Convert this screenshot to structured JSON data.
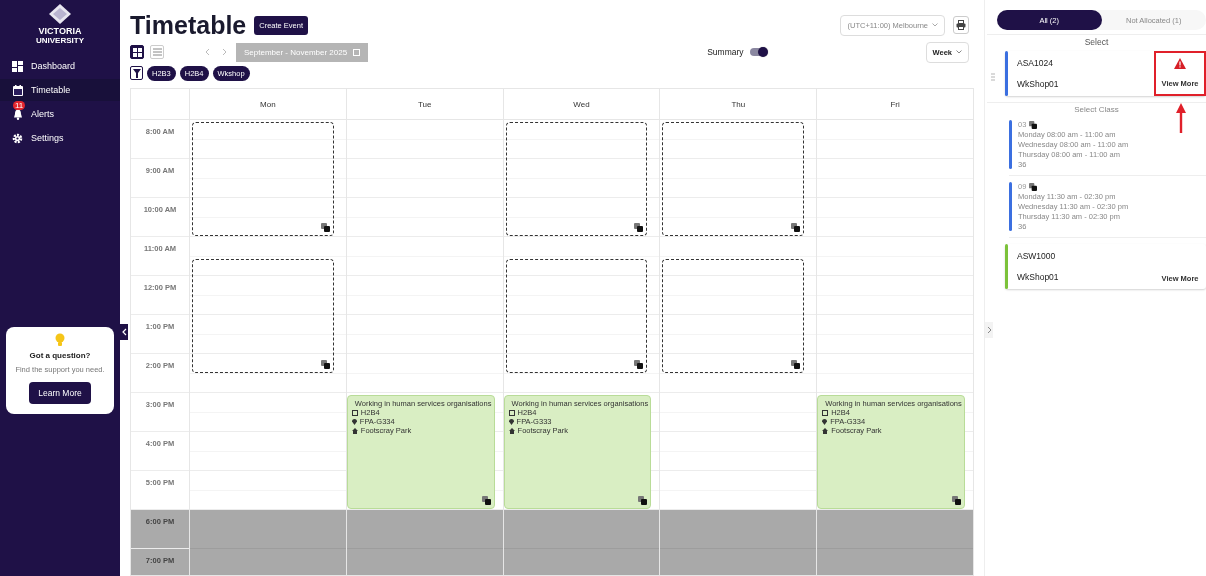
{
  "sidebar": {
    "logo": [
      "VICTORIA",
      "UNIVERSITY"
    ],
    "items": [
      {
        "label": "Dashboard",
        "selected": false
      },
      {
        "label": "Timetable",
        "selected": true
      },
      {
        "label": "Alerts",
        "selected": false,
        "badge": "11"
      },
      {
        "label": "Settings",
        "selected": false
      }
    ],
    "help": {
      "title": "Got a question?",
      "text": "Find the support you need.",
      "button": "Learn More"
    }
  },
  "header": {
    "title": "Timetable",
    "create_button": "Create Event",
    "timezone": "(UTC+11:00) Melbourne",
    "views": [
      {
        "kind": "grid",
        "selected": true
      },
      {
        "kind": "list",
        "selected": false
      }
    ],
    "date_range": {
      "label": "September - November 2025",
      "disabled": true
    },
    "summary": {
      "label": "Summary",
      "on": true
    },
    "period": "Week",
    "filters": [
      "H2B3",
      "H2B4",
      "Wkshop"
    ]
  },
  "calendar": {
    "days": [
      {
        "label": "Mon",
        "events": [
          {
            "kind": "placeholder"
          },
          {
            "kind": "placeholder"
          }
        ]
      },
      {
        "label": "Tue",
        "events": [
          {
            "kind": "class",
            "title": "Working in human services organisations",
            "group": "H2B4",
            "room": "FPA-G334",
            "campus": "Footscray Park"
          }
        ]
      },
      {
        "label": "Wed",
        "events": [
          {
            "kind": "placeholder"
          },
          {
            "kind": "placeholder"
          },
          {
            "kind": "class",
            "title": "Working in human services organisations",
            "group": "H2B4",
            "room": "FPA-G333",
            "campus": "Footscray Park"
          }
        ]
      },
      {
        "label": "Thu",
        "events": [
          {
            "kind": "placeholder"
          },
          {
            "kind": "placeholder"
          }
        ]
      },
      {
        "label": "Fri",
        "events": [
          {
            "kind": "class",
            "title": "Working in human services organisations",
            "group": "H2B4",
            "room": "FPA-G334",
            "campus": "Footscray Park"
          }
        ]
      }
    ],
    "hours": [
      {
        "label": "8:00 AM",
        "disabled": false
      },
      {
        "label": "9:00 AM",
        "disabled": false
      },
      {
        "label": "10:00 AM",
        "disabled": false
      },
      {
        "label": "11:00 AM",
        "disabled": false
      },
      {
        "label": "12:00 PM",
        "disabled": false
      },
      {
        "label": "1:00 PM",
        "disabled": false
      },
      {
        "label": "2:00 PM",
        "disabled": false
      },
      {
        "label": "3:00 PM",
        "disabled": false
      },
      {
        "label": "4:00 PM",
        "disabled": false
      },
      {
        "label": "5:00 PM",
        "disabled": false
      },
      {
        "label": "6:00 PM",
        "disabled": true
      },
      {
        "label": "7:00 PM",
        "disabled": true
      }
    ]
  },
  "panel": {
    "tabs": [
      {
        "label": "All (2)",
        "selected": true
      },
      {
        "label": "Not Allocated (1)",
        "selected": false
      }
    ],
    "select_label": "Select",
    "courses": [
      {
        "code": "ASA1024",
        "group": "WkShop01",
        "color": "#3b6fe0",
        "warning": true,
        "highlighted": true,
        "link": "View More",
        "class_heading": "Select Class",
        "classes": [
          {
            "number": "03",
            "times": [
              "Monday 08:00 am - 11:00 am",
              "Wednesday 08:00 am - 11:00 am",
              "Thursday 08:00 am - 11:00 am"
            ],
            "count": "36"
          },
          {
            "number": "09",
            "times": [
              "Monday 11:30 am - 02:30 pm",
              "Wednesday 11:30 am - 02:30 pm",
              "Thursday 11:30 am - 02:30 pm"
            ],
            "count": "36"
          }
        ]
      },
      {
        "code": "ASW1000",
        "group": "WkShop01",
        "color": "#7cc23a",
        "warning": false,
        "highlighted": false,
        "link": "View More"
      }
    ]
  }
}
